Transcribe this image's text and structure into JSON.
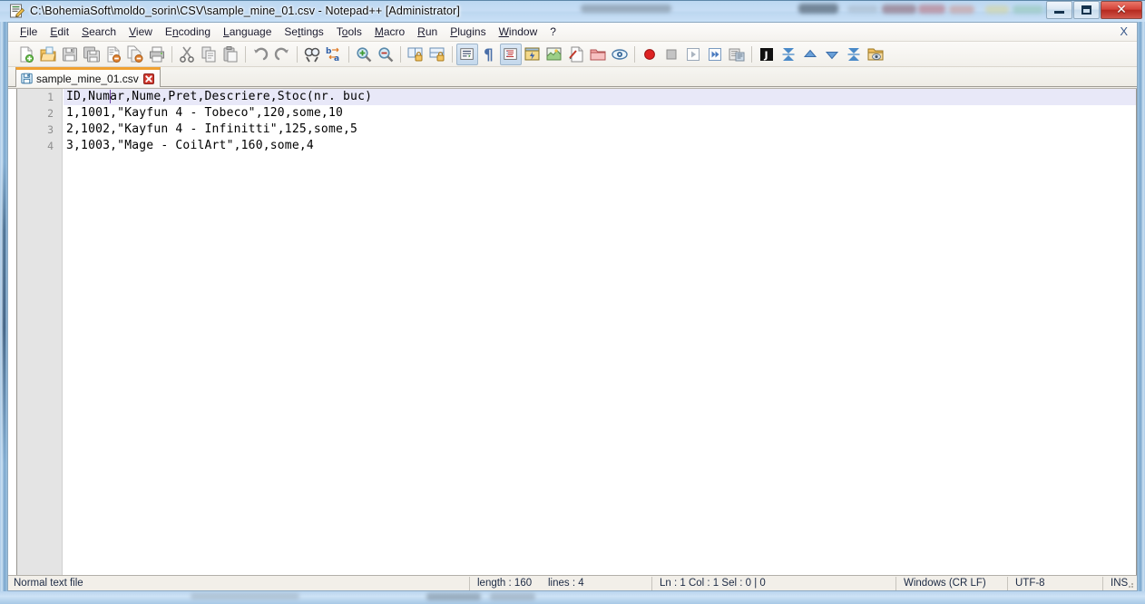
{
  "window": {
    "title": "C:\\BohemiaSoft\\moldo_sorin\\CSV\\sample_mine_01.csv - Notepad++ [Administrator]",
    "app_icon": "notepad-plus-plus-icon",
    "minimize_label": "",
    "maximize_label": "",
    "close_label": "✕"
  },
  "menubar": {
    "items": [
      {
        "label": "File",
        "accel": "F"
      },
      {
        "label": "Edit",
        "accel": "E"
      },
      {
        "label": "Search",
        "accel": "S"
      },
      {
        "label": "View",
        "accel": "V"
      },
      {
        "label": "Encoding",
        "accel": "n"
      },
      {
        "label": "Language",
        "accel": "L"
      },
      {
        "label": "Settings",
        "accel": "t"
      },
      {
        "label": "Tools",
        "accel": "o"
      },
      {
        "label": "Macro",
        "accel": "M"
      },
      {
        "label": "Run",
        "accel": "R"
      },
      {
        "label": "Plugins",
        "accel": "P"
      },
      {
        "label": "Window",
        "accel": "W"
      },
      {
        "label": "?",
        "accel": ""
      }
    ],
    "close_doc_label": "X"
  },
  "toolbar": {
    "buttons": [
      {
        "name": "new-file-icon",
        "tooltip": "New"
      },
      {
        "name": "open-file-icon",
        "tooltip": "Open"
      },
      {
        "name": "save-icon",
        "tooltip": "Save"
      },
      {
        "name": "save-all-icon",
        "tooltip": "Save All"
      },
      {
        "name": "close-file-icon",
        "tooltip": "Close"
      },
      {
        "name": "close-all-icon",
        "tooltip": "Close All"
      },
      {
        "name": "print-icon",
        "tooltip": "Print"
      },
      {
        "name": "separator",
        "tooltip": ""
      },
      {
        "name": "cut-icon",
        "tooltip": "Cut"
      },
      {
        "name": "copy-icon",
        "tooltip": "Copy"
      },
      {
        "name": "paste-icon",
        "tooltip": "Paste"
      },
      {
        "name": "separator",
        "tooltip": ""
      },
      {
        "name": "undo-icon",
        "tooltip": "Undo"
      },
      {
        "name": "redo-icon",
        "tooltip": "Redo"
      },
      {
        "name": "separator",
        "tooltip": ""
      },
      {
        "name": "find-icon",
        "tooltip": "Find"
      },
      {
        "name": "replace-icon",
        "tooltip": "Replace"
      },
      {
        "name": "separator",
        "tooltip": ""
      },
      {
        "name": "zoom-in-icon",
        "tooltip": "Zoom In"
      },
      {
        "name": "zoom-out-icon",
        "tooltip": "Zoom Out"
      },
      {
        "name": "separator",
        "tooltip": ""
      },
      {
        "name": "sync-vertical-scroll-icon",
        "tooltip": "Synchronize Vertical Scrolling"
      },
      {
        "name": "sync-horizontal-scroll-icon",
        "tooltip": "Synchronize Horizontal Scrolling"
      },
      {
        "name": "separator",
        "tooltip": ""
      },
      {
        "name": "word-wrap-icon",
        "tooltip": "Word wrap"
      },
      {
        "name": "show-all-chars-icon",
        "tooltip": "Show All Characters"
      },
      {
        "name": "show-indent-guide-icon",
        "tooltip": "Show Indent Guide"
      },
      {
        "name": "user-defined-dialog-icon",
        "tooltip": "User Defined Dialogue"
      },
      {
        "name": "document-map-icon",
        "tooltip": "Document Map"
      },
      {
        "name": "function-list-icon",
        "tooltip": "Function List"
      },
      {
        "name": "folder-workspace-icon",
        "tooltip": "Folder as Workspace"
      },
      {
        "name": "monitoring-icon",
        "tooltip": "Monitoring (tail -f)"
      },
      {
        "name": "separator",
        "tooltip": ""
      },
      {
        "name": "record-macro-icon",
        "tooltip": "Start Recording"
      },
      {
        "name": "stop-macro-icon",
        "tooltip": "Stop Recording"
      },
      {
        "name": "play-macro-icon",
        "tooltip": "Playback"
      },
      {
        "name": "play-macro-multiple-icon",
        "tooltip": "Run a Macro Multiple Times"
      },
      {
        "name": "save-macro-icon",
        "tooltip": "Save Currently Recorded Macro"
      },
      {
        "name": "separator",
        "tooltip": ""
      },
      {
        "name": "run-icon",
        "tooltip": "Run"
      },
      {
        "name": "collapse-all-icon",
        "tooltip": "Collapse All"
      },
      {
        "name": "fold-level-up-icon",
        "tooltip": "Fold Level Up"
      },
      {
        "name": "unfold-level-down-icon",
        "tooltip": "Unfold Level Down"
      },
      {
        "name": "expand-all-icon",
        "tooltip": "Uncollapse All"
      },
      {
        "name": "open-folder-icon",
        "tooltip": "Open containing folder"
      }
    ]
  },
  "tabs": {
    "active_index": 0,
    "items": [
      {
        "label": "sample_mine_01.csv",
        "icon": "saved-document-icon",
        "close": "✕"
      }
    ]
  },
  "editor": {
    "line_numbers": [
      "1",
      "2",
      "3",
      "4"
    ],
    "lines": [
      "ID,Numar,Nume,Pret,Descriere,Stoc(nr. buc)",
      "1,1001,\"Kayfun 4 - Tobeco\",120,some,10",
      "2,1002,\"Kayfun 4 - Infinitti\",125,some,5",
      "3,1003,\"Mage - CoilArt\",160,some,4"
    ],
    "current_line_index": 0,
    "caret_line": 1,
    "caret_col": 1
  },
  "statusbar": {
    "file_type": "Normal text file",
    "length_label": "length : 160",
    "lines_label": "lines : 4",
    "position": "Ln : 1    Col : 1    Sel : 0 | 0",
    "eol": "Windows (CR LF)",
    "encoding": "UTF-8",
    "insert_mode": "INS"
  },
  "colors": {
    "accent_tab_top": "#f0a030",
    "current_line_highlight": "#e8e8f8",
    "caret": "#6a3fa0",
    "close_button": "#d6453a",
    "glass": "#c6ddf4"
  }
}
